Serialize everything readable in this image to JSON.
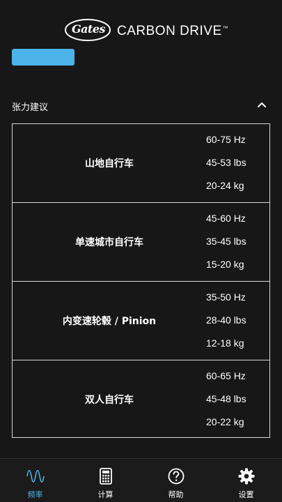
{
  "header": {
    "brand_script": "Gates",
    "brand_text": "CARBON DRIVE",
    "brand_tm": "™"
  },
  "section": {
    "title": "张力建议",
    "expanded": true
  },
  "table": {
    "rows": [
      {
        "label": "山地自行车",
        "values": [
          "60-75 Hz",
          "45-53 lbs",
          "20-24 kg"
        ]
      },
      {
        "label": "单速城市自行车",
        "values": [
          "45-60 Hz",
          "35-45 lbs",
          "15-20 kg"
        ]
      },
      {
        "label": "内变速轮毂 / Pinion",
        "values": [
          "35-50 Hz",
          "28-40 lbs",
          "12-18 kg"
        ]
      },
      {
        "label": "双人自行车",
        "values": [
          "60-65 Hz",
          "45-48 lbs",
          "20-22 kg"
        ]
      }
    ]
  },
  "nav": {
    "items": [
      {
        "label": "频率",
        "icon": "waveform-icon",
        "active": true
      },
      {
        "label": "计算",
        "icon": "calculator-icon",
        "active": false
      },
      {
        "label": "帮助",
        "icon": "help-icon",
        "active": false
      },
      {
        "label": "设置",
        "icon": "gear-icon",
        "active": false
      }
    ]
  },
  "colors": {
    "accent": "#4db4ea",
    "background": "#171717",
    "border": "#d9d9d9"
  }
}
